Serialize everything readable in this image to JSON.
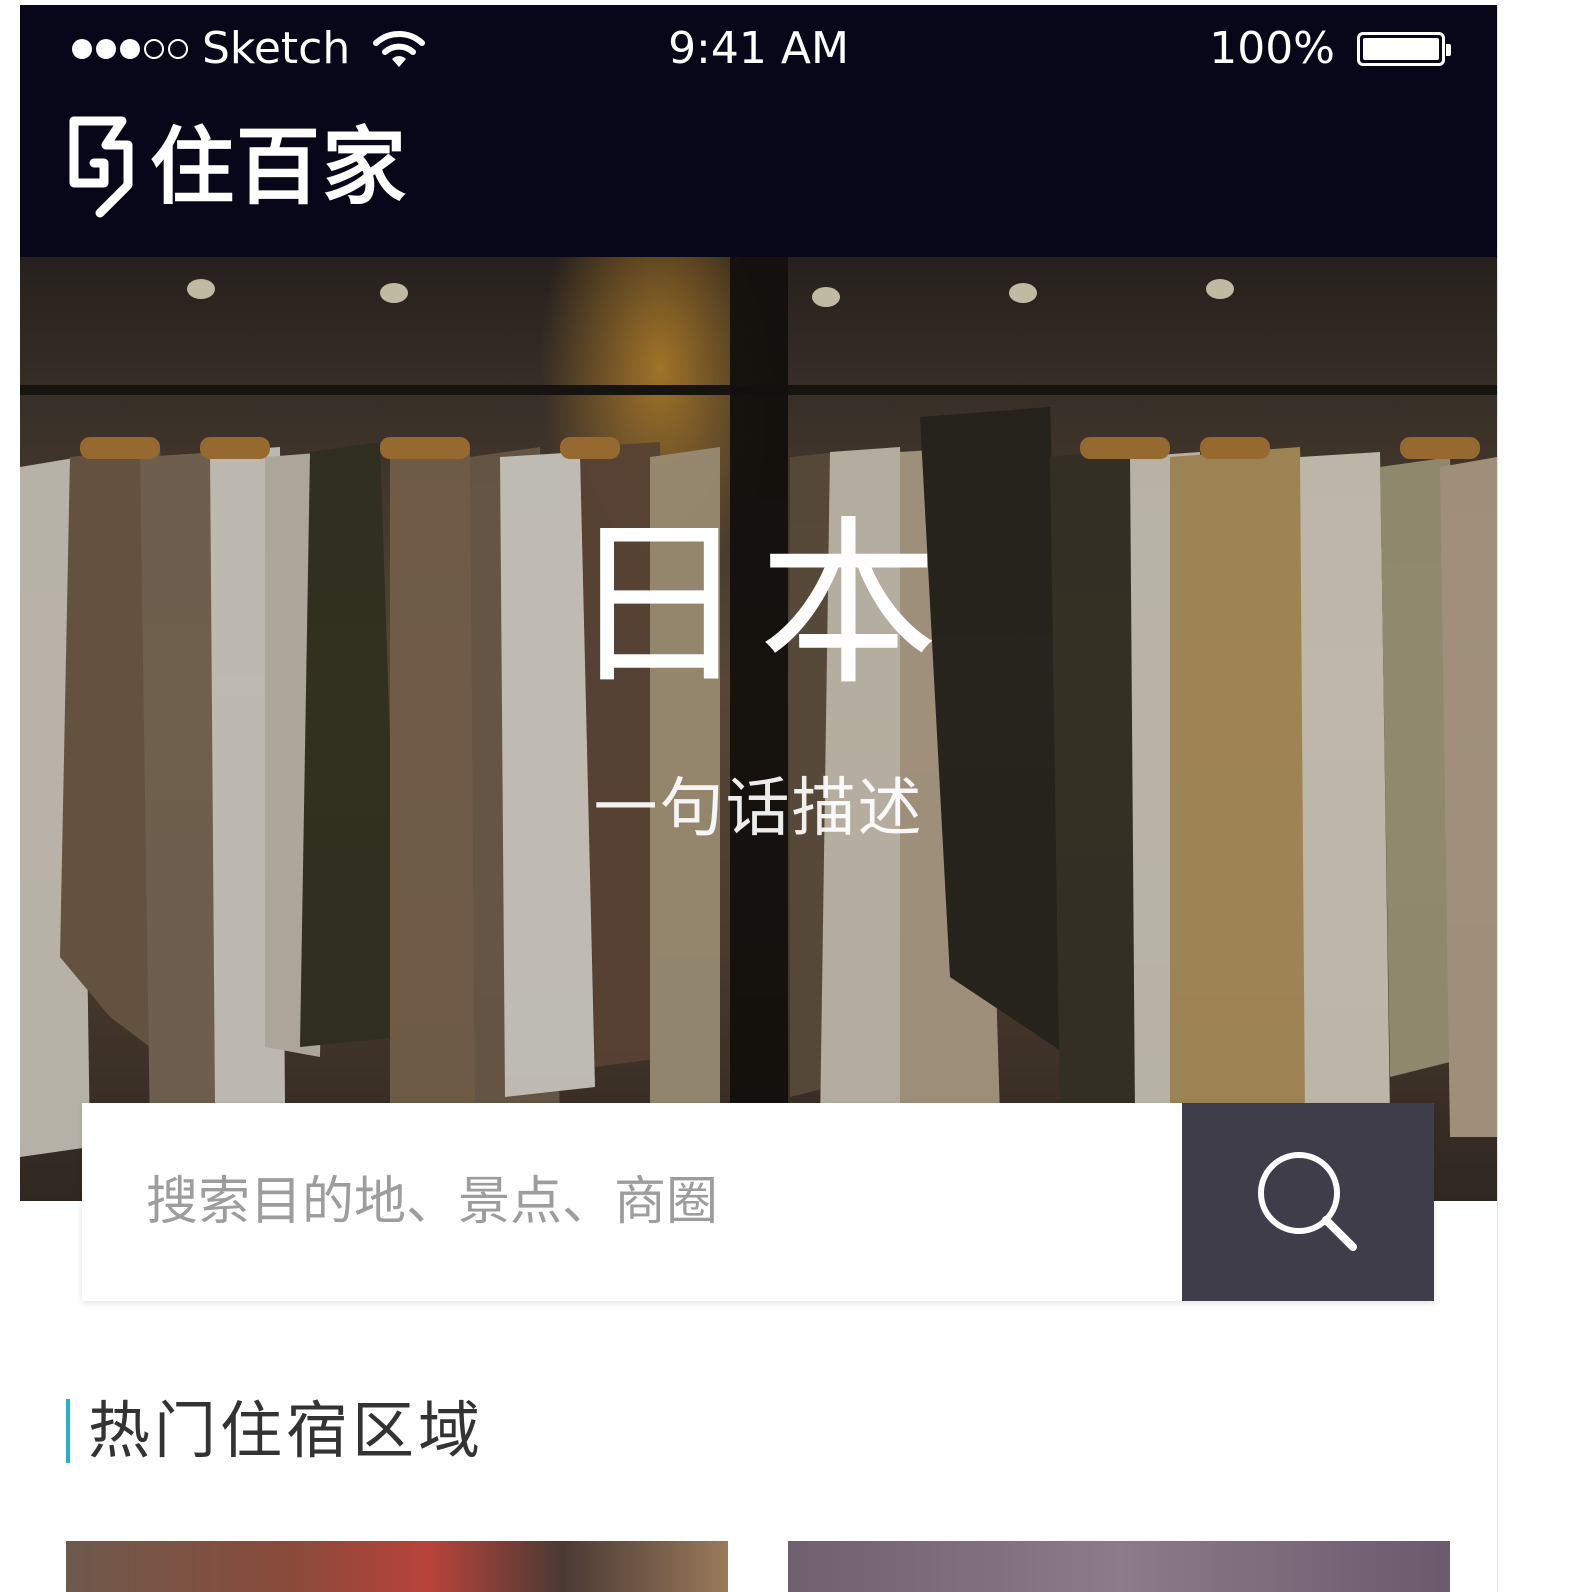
{
  "status_bar": {
    "carrier": "Sketch",
    "time": "9:41 AM",
    "battery": "100%",
    "signal_bars": 3,
    "signal_total": 5,
    "icons": [
      "wifi-icon",
      "battery-icon"
    ]
  },
  "header": {
    "brand_name": "住百家",
    "logo_icon": "brand-logo-icon"
  },
  "hero": {
    "title": "日本",
    "subtitle": "一句话描述"
  },
  "search": {
    "placeholder": "搜索目的地、景点、商圈",
    "button_icon": "search-icon"
  },
  "section": {
    "title": "热门住宿区域"
  },
  "colors": {
    "topbar_bg": "#08071a",
    "search_button_bg": "#3f3d4a",
    "section_accent": "#2bb0c2"
  }
}
